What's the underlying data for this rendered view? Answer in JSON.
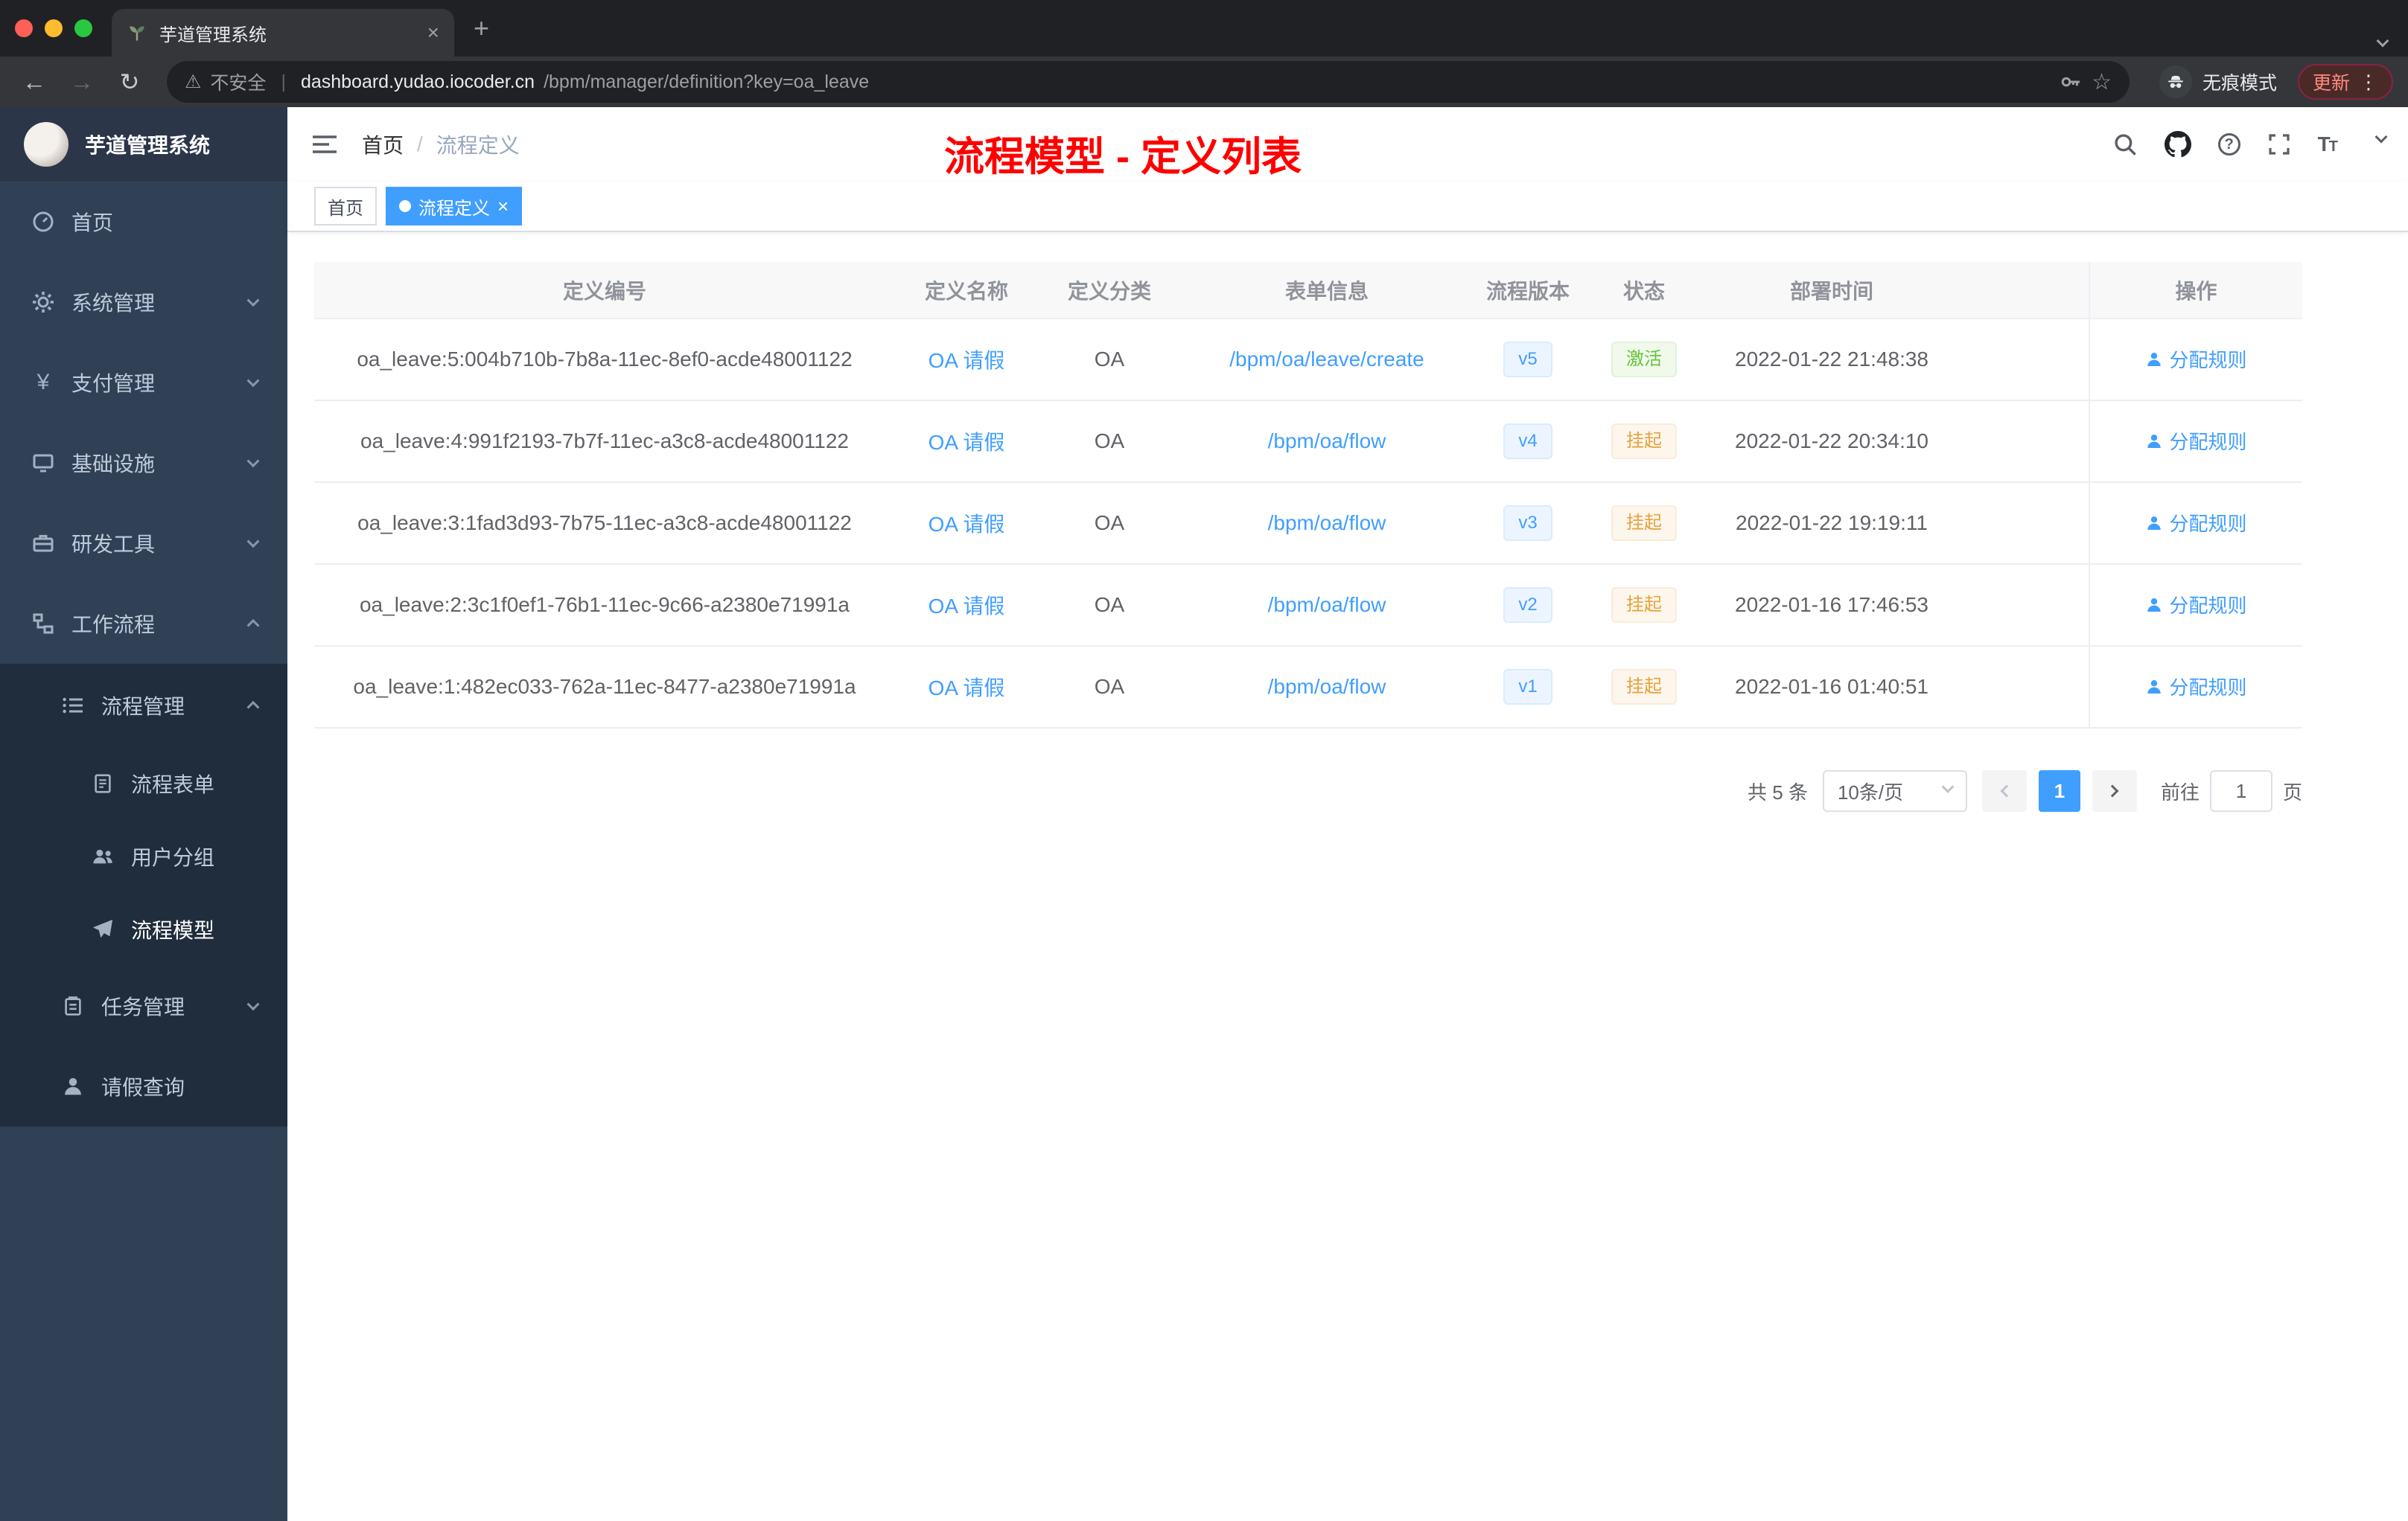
{
  "browser": {
    "tab_title": "芋道管理系统",
    "new_tab": "+",
    "security_label": "不安全",
    "url_host": "dashboard.yudao.iocoder.cn",
    "url_path": "/bpm/manager/definition?key=oa_leave",
    "incognito_label": "无痕模式",
    "update_label": "更新"
  },
  "sidebar": {
    "logo_title": "芋道管理系统",
    "items": [
      {
        "label": "首页",
        "icon": "dashboard-icon"
      },
      {
        "label": "系统管理",
        "icon": "gear-icon"
      },
      {
        "label": "支付管理",
        "icon": "yen-icon"
      },
      {
        "label": "基础设施",
        "icon": "monitor-icon"
      },
      {
        "label": "研发工具",
        "icon": "toolbox-icon"
      },
      {
        "label": "工作流程",
        "icon": "workflow-icon"
      },
      {
        "label": "流程管理",
        "icon": "process-list-icon"
      },
      {
        "label": "流程表单",
        "icon": "form-icon"
      },
      {
        "label": "用户分组",
        "icon": "user-group-icon"
      },
      {
        "label": "流程模型",
        "icon": "paper-plane-icon"
      },
      {
        "label": "任务管理",
        "icon": "clipboard-icon"
      },
      {
        "label": "请假查询",
        "icon": "person-icon"
      }
    ]
  },
  "header": {
    "breadcrumb": [
      "首页",
      "流程定义"
    ],
    "breadcrumb_separator": "/",
    "annotation": "流程模型 - 定义列表"
  },
  "tags": [
    {
      "label": "首页",
      "active": false
    },
    {
      "label": "流程定义",
      "active": true
    }
  ],
  "table": {
    "columns": [
      "定义编号",
      "定义名称",
      "定义分类",
      "表单信息",
      "流程版本",
      "状态",
      "部署时间",
      "操作"
    ],
    "rows": [
      {
        "id": "oa_leave:5:004b710b-7b8a-11ec-8ef0-acde48001122",
        "name": "OA 请假",
        "category": "OA",
        "form": "/bpm/oa/leave/create",
        "version": "v5",
        "status": "激活",
        "time": "2022-01-22 21:48:38",
        "action": "分配规则"
      },
      {
        "id": "oa_leave:4:991f2193-7b7f-11ec-a3c8-acde48001122",
        "name": "OA 请假",
        "category": "OA",
        "form": "/bpm/oa/flow",
        "version": "v4",
        "status": "挂起",
        "time": "2022-01-22 20:34:10",
        "action": "分配规则"
      },
      {
        "id": "oa_leave:3:1fad3d93-7b75-11ec-a3c8-acde48001122",
        "name": "OA 请假",
        "category": "OA",
        "form": "/bpm/oa/flow",
        "version": "v3",
        "status": "挂起",
        "time": "2022-01-22 19:19:11",
        "action": "分配规则"
      },
      {
        "id": "oa_leave:2:3c1f0ef1-76b1-11ec-9c66-a2380e71991a",
        "name": "OA 请假",
        "category": "OA",
        "form": "/bpm/oa/flow",
        "version": "v2",
        "status": "挂起",
        "time": "2022-01-16 17:46:53",
        "action": "分配规则"
      },
      {
        "id": "oa_leave:1:482ec033-762a-11ec-8477-a2380e71991a",
        "name": "OA 请假",
        "category": "OA",
        "form": "/bpm/oa/flow",
        "version": "v1",
        "status": "挂起",
        "time": "2022-01-16 01:40:51",
        "action": "分配规则"
      }
    ]
  },
  "pagination": {
    "total": "共 5 条",
    "page_size": "10条/页",
    "current_page": "1",
    "goto_label": "前往",
    "goto_value": "1",
    "goto_unit": "页"
  },
  "colors": {
    "accent": "#409eff",
    "sidebar_bg": "#304156",
    "submenu_bg": "#1f2d3d",
    "annotation_red": "#ff0000",
    "status_active_green": "#67c23a",
    "status_suspend_orange": "#e6a23c"
  }
}
